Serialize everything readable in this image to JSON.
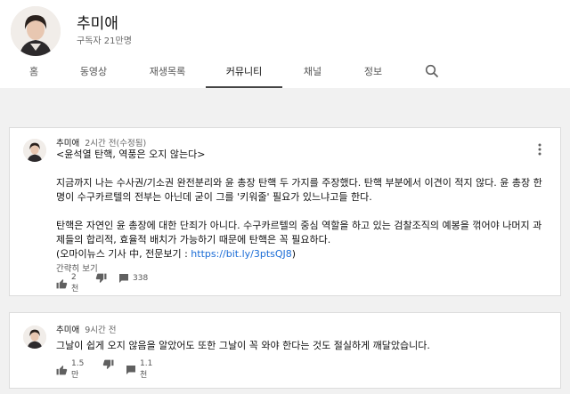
{
  "channel": {
    "name": "추미애",
    "subscribers": "구독자 21만명"
  },
  "tabs": [
    {
      "label": "홈"
    },
    {
      "label": "동영상"
    },
    {
      "label": "재생목록"
    },
    {
      "label": "커뮤니티"
    },
    {
      "label": "채널"
    },
    {
      "label": "정보"
    }
  ],
  "active_tab": "커뮤니티",
  "posts": [
    {
      "author": "추미애",
      "time": "2시간 전(수정됨)",
      "title": "<윤석열 탄핵, 역풍은 오지 않는다>",
      "para1": "지금까지 나는 수사권/기소권 완전분리와 윤 총장 탄핵 두 가지를 주장했다. 탄핵 부분에서 이견이 적지 않다. 윤 총장 한 명이 수구카르텔의 전부는 아닌데 굳이 그를 '키워줄' 필요가 있느냐고들 한다.",
      "para2": "탄핵은 자연인 윤 총장에 대한 단죄가 아니다. 수구카르텔의 중심 역할을 하고 있는 검찰조직의 예봉을 꺾어야 나머지 과제들의 합리적, 효율적 배치가 가능하기 때문에 탄핵은 꼭 필요하다.",
      "source_prefix": "(오마이뉴스 기사 中, 전문보기 : ",
      "source_link": "https://bit.ly/3ptsQJ8",
      "source_suffix": ")",
      "more": "간략히 보기",
      "likes": "2천",
      "comments": "338"
    },
    {
      "author": "추미애",
      "time": "9시간 전",
      "text": "그날이 쉽게 오지 않음을 알았어도 또한 그날이 꼭 와야 한다는 것도 절실하게 깨달았습니다.",
      "likes": "1.5만",
      "comments": "1.1천"
    }
  ]
}
